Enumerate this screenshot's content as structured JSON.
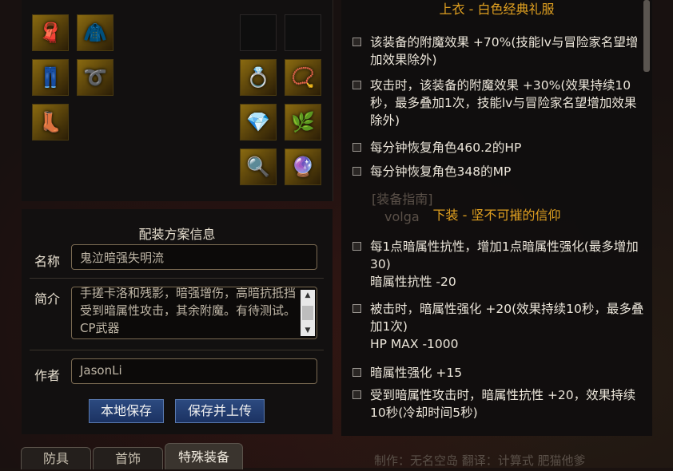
{
  "equipment": {
    "left_slots": [
      {
        "icon": "scarf-icon",
        "glyph": "🧣"
      },
      {
        "icon": "jacket-icon",
        "glyph": "🧥"
      },
      {
        "icon": "pants-icon",
        "glyph": "👖"
      },
      {
        "icon": "belt-icon",
        "glyph": "➰"
      },
      {
        "icon": "shoe-icon",
        "glyph": "👢"
      }
    ],
    "right_slots": [
      {
        "icon": "bracelet-icon",
        "glyph": "💍"
      },
      {
        "icon": "necklace-icon",
        "glyph": "📿"
      },
      {
        "icon": "ring-icon",
        "glyph": "💎"
      },
      {
        "icon": "gem-pouch-icon",
        "glyph": "🌿"
      },
      {
        "icon": "magnifier-icon",
        "glyph": "🔍"
      },
      {
        "icon": "orb-icon",
        "glyph": "🔮"
      }
    ]
  },
  "config": {
    "title": "配装方案信息",
    "name_label": "名称",
    "name_value": "鬼泣暗强失明流",
    "desc_label": "简介",
    "desc_value": "手搓卡洛和残影，暗强增伤，高暗抗抵挡受到暗属性攻击，其余附魔。有待测试。CP武器",
    "author_label": "作者",
    "author_value": "JasonLi",
    "save_local": "本地保存",
    "save_upload": "保存并上传"
  },
  "bottom_tabs": [
    {
      "label": "防具",
      "active": false
    },
    {
      "label": "首饰",
      "active": false
    },
    {
      "label": "特殊装备",
      "active": true
    }
  ],
  "details": {
    "sections": [
      {
        "title": "上衣 - 白色经典礼服",
        "items": [
          {
            "text": "该装备的附魔效果 +70%(技能lv与冒险家名望增加效果除外)",
            "sub": ""
          },
          {
            "text": "攻击时，该装备的附魔效果 +30%(效果持续10秒，最多叠加1次，技能lv与冒险家名望增加效果除外)",
            "sub": ""
          },
          {
            "text": "每分钟恢复角色460.2的HP",
            "sub": ""
          },
          {
            "text": "每分钟恢复角色348的MP",
            "sub": ""
          }
        ]
      },
      {
        "title": "下装 - 坚不可摧的信仰",
        "items": [
          {
            "text": "每1点暗属性抗性，增加1点暗属性强化(最多增加30)",
            "sub": "暗属性抗性 -20"
          },
          {
            "text": "被击时，暗属性强化 +20(效果持续10秒，最多叠加1次)",
            "sub": "HP MAX -1000"
          },
          {
            "text": "暗属性强化 +15",
            "sub": ""
          },
          {
            "text": "受到暗属性攻击时，暗属性抗性 +20，效果持续10秒(冷却时间5秒)",
            "sub": ""
          }
        ]
      }
    ],
    "ghost_guide": "[装备指南]",
    "ghost_author": "volga",
    "ghost_footer": "制作：无名空岛 翻译：计算式 肥猫他爹"
  }
}
